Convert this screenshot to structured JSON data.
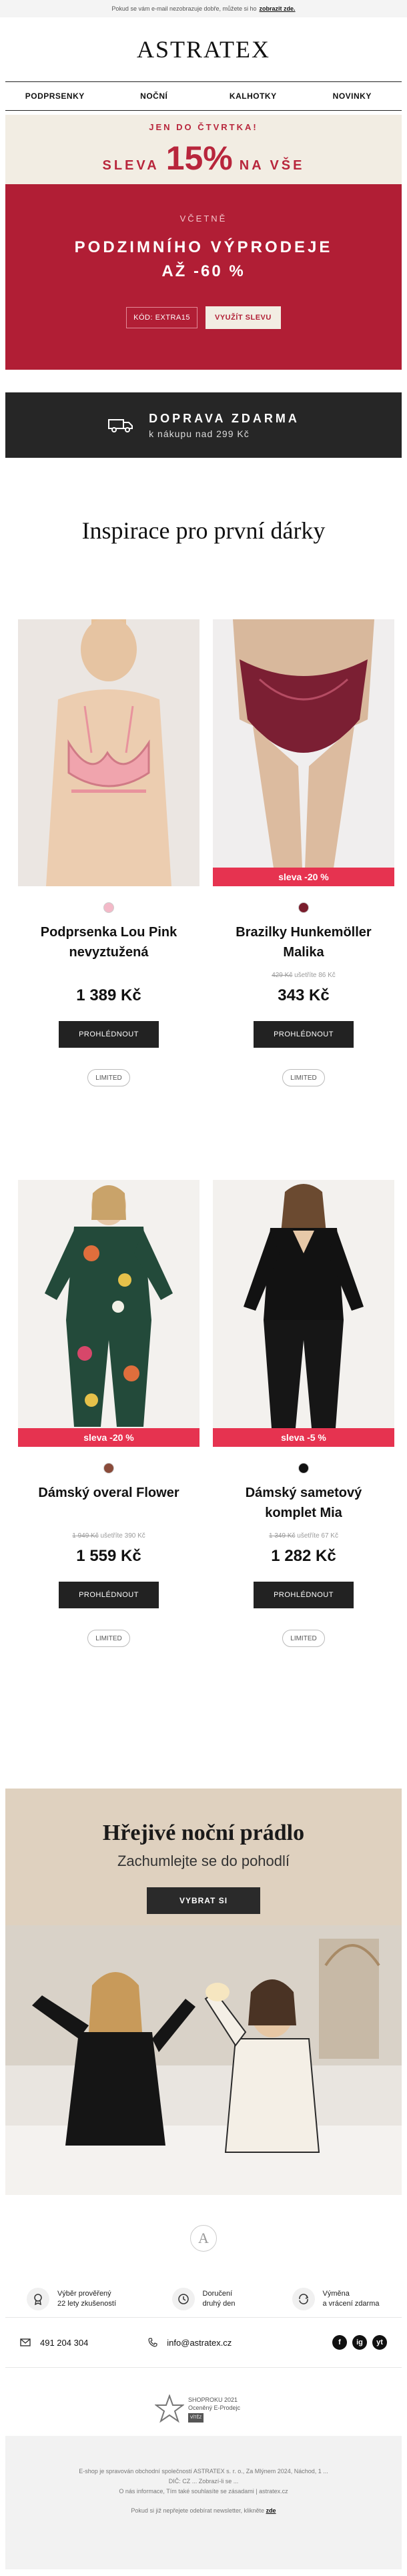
{
  "preheader": {
    "text": "Pokud se vám e-mail nezobrazuje dobře, můžete si ho",
    "link": "zobrazit zde."
  },
  "brand": {
    "logo": "ASTRATEX"
  },
  "nav": {
    "items": [
      "PODPRSENKY",
      "NOČNÍ",
      "KALHOTKY",
      "NOVINKY"
    ]
  },
  "promo": {
    "until": "JEN DO ČTVRTKA!",
    "word_left": "SLEVA",
    "percent": "15%",
    "word_right": "NA VŠE",
    "including": "VČETNĚ",
    "title": "PODZIMNÍHO VÝPRODEJE",
    "subtitle": "AŽ -60 %",
    "code_label": "KÓD: EXTRA15",
    "use_button": "VYUŽÍT SLEVU"
  },
  "shipping": {
    "title": "DOPRAVA ZDARMA",
    "subtitle": "k nákupu nad 299 Kč",
    "icon": "truck-icon"
  },
  "gifts": {
    "title": "Inspirace pro první dárky",
    "products": [
      {
        "name": "Podprsenka Lou Pink nevyztužená",
        "badge": "",
        "old_price": "",
        "price": "1 389 Kč",
        "button": "PROHLÉDNOUT",
        "tag": "LIMITED",
        "swatch_color": "#f3b9c8"
      },
      {
        "name": "Brazilky Hunkemöller Malika",
        "badge": "sleva -20 %",
        "old_price_struck": "429 Kč",
        "old_price_note": "ušetříte 86 Kč",
        "price": "343 Kč",
        "button": "PROHLÉDNOUT",
        "tag": "LIMITED",
        "swatch_color": "#7a1d2c"
      },
      {
        "name": "Dámský overal Flower",
        "badge": "sleva -20 %",
        "old_price_struck": "1 949 Kč",
        "old_price_note": "ušetříte 390 Kč",
        "price": "1 559 Kč",
        "button": "PROHLÉDNOUT",
        "tag": "LIMITED",
        "swatch_color": "#8a4b3a"
      },
      {
        "name": "Dámský sametový komplet Mia",
        "badge": "sleva -5 %",
        "old_price_struck": "1 349 Kč",
        "old_price_note": "ušetříte 67 Kč",
        "price": "1 282 Kč",
        "button": "PROHLÉDNOUT",
        "tag": "LIMITED",
        "swatch_color": "#111111"
      }
    ]
  },
  "warm": {
    "title": "Hřejivé noční prádlo",
    "subtitle": "Zachumlejte se do pohodlí",
    "button": "VYBRAT SI"
  },
  "footer": {
    "logo_letter": "A",
    "benefits": [
      {
        "icon": "award-icon",
        "line1": "Výběr prověřený",
        "line2": "22 lety zkušeností"
      },
      {
        "icon": "clock-icon",
        "line1": "Doručení",
        "line2": "druhý den"
      },
      {
        "icon": "return-icon",
        "line1": "Výměna",
        "line2": "a vrácení zdarma"
      }
    ],
    "phone": "491 204 304",
    "email": "info@astratex.cz",
    "social": [
      "f",
      "ig",
      "yt"
    ],
    "award_line1": "SHOPROKU 2021",
    "award_line2": "Oceněný E-Prodejc",
    "award_tag": "VÍTĚZ",
    "legal1": "E-shop je spravován obchodní společností ASTRATEX s. r. o., Za Mlýnem 2024, Náchod, 1 ...",
    "legal2": "DIČ: CZ ... Zobrazí-li se ...",
    "legal3": "O nás informace, Tím také souhlasíte se zásadami | astratex.cz",
    "unsub_text": "Pokud si již nepřejete odebírat newsletter, klikněte",
    "unsub_link": "zde"
  },
  "colors": {
    "brand_red": "#b11e35",
    "sale_badge": "#e63350",
    "cream": "#f2ede3",
    "dark": "#262626"
  }
}
